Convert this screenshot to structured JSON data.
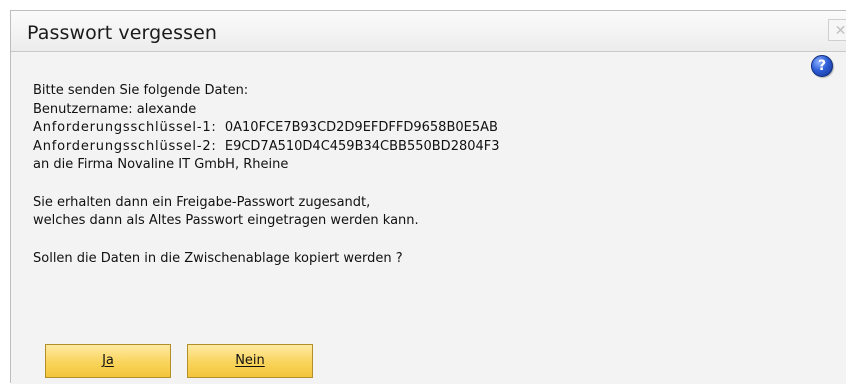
{
  "dialog": {
    "title": "Passwort vergessen",
    "close_label": "✕"
  },
  "message": {
    "line1": "Bitte senden Sie folgende Daten:",
    "line2": "Benutzername: alexande",
    "line3_label": "Anforderungsschlüssel-1:",
    "line3_value": "0A10FCE7B93CD2D9EFDFFD9658B0E5AB",
    "line4_label": "Anforderungsschlüssel-2:",
    "line4_value": "E9CD7A510D4C459B34CBB550BD2804F3",
    "line5": "an die Firma Novaline IT GmbH, Rheine",
    "line6": "Sie erhalten dann ein Freigabe-Passwort zugesandt,",
    "line7": "welches dann als Altes Passwort eingetragen werden kann.",
    "line8": "Sollen die Daten in die Zwischenablage kopiert werden ?"
  },
  "help_icon": {
    "glyph": "?",
    "name": "help-icon"
  },
  "buttons": {
    "yes_label": "Ja",
    "no_label": "Nein"
  },
  "colors": {
    "button_accent": "#f9d45b",
    "body_background": "#f3f3f3",
    "help_icon": "#2f5fd8"
  }
}
